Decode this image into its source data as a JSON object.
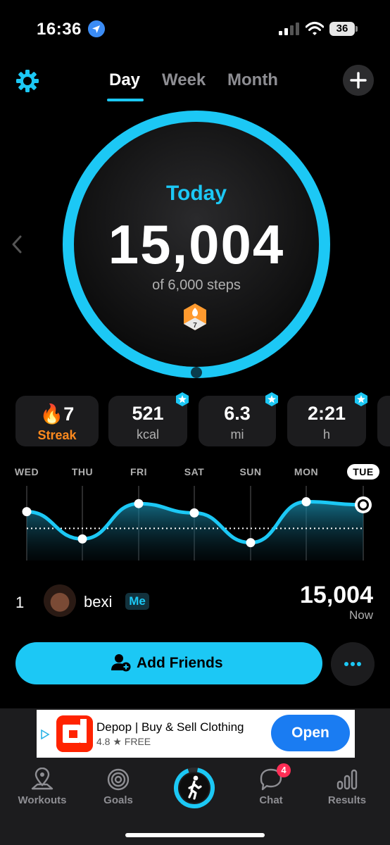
{
  "status_bar": {
    "time": "16:36",
    "battery": "36"
  },
  "header": {
    "tabs": [
      {
        "label": "Day",
        "active": true
      },
      {
        "label": "Week",
        "active": false
      },
      {
        "label": "Month",
        "active": false
      }
    ]
  },
  "summary": {
    "label": "Today",
    "steps": "15,004",
    "goal_text": "of 6,000 steps",
    "medal_number": "7",
    "progress_fraction": 1.0
  },
  "stats": [
    {
      "value": "7",
      "unit": "Streak"
    },
    {
      "value": "521",
      "unit": "kcal"
    },
    {
      "value": "6.3",
      "unit": "mi"
    },
    {
      "value": "2:21",
      "unit": "h"
    }
  ],
  "week_chart": {
    "days": [
      "WED",
      "THU",
      "FRI",
      "SAT",
      "SUN",
      "MON",
      "TUE"
    ],
    "relative_values": [
      0.72,
      0.28,
      0.85,
      0.7,
      0.22,
      0.88,
      0.83
    ],
    "goal_line_level": 0.45
  },
  "leaderboard": {
    "rank": "1",
    "name": "bexi",
    "badge": "Me",
    "steps": "15,004",
    "time": "Now"
  },
  "add_friends_label": "Add Friends",
  "ad": {
    "title": "Depop | Buy & Sell Clothing",
    "rating": "4.8 ★ FREE",
    "cta": "Open"
  },
  "tab_bar": {
    "items": [
      "Workouts",
      "Goals",
      "Chat",
      "Results"
    ],
    "chat_badge": "4"
  },
  "colors": {
    "accent": "#1cc8f5",
    "streak": "#ff8a1e",
    "background": "#000000"
  }
}
